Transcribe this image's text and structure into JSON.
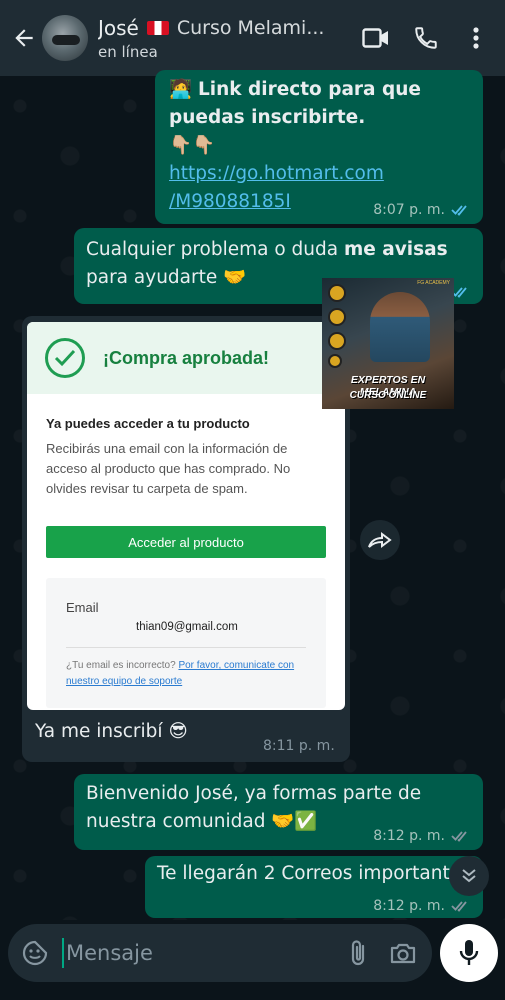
{
  "header": {
    "contact_name": "José",
    "title_extra": "Curso Melami...",
    "status": "en línea",
    "icons": [
      "back-arrow-icon",
      "video-call-icon",
      "phone-icon",
      "more-options-icon"
    ]
  },
  "messages": {
    "m1": {
      "line1": "Link directo para que",
      "line2": "puedas inscribirte.",
      "link_line1": "https://go.hotmart.com",
      "link_line2": "/M98088185I",
      "time": "8:07 p. m."
    },
    "m2": {
      "text_before": "Cualquier problema o duda ",
      "text_bold": "me avisas",
      "line2": "para ayudarte 🤝"
    },
    "m3": {
      "text": "Ya me inscribí 😎",
      "time": "8:11 p. m."
    },
    "m4": {
      "line1": "Bienvenido José, ya formas parte de",
      "line2": "nuestra comunidad 🤝✅",
      "time": "8:12 p. m."
    },
    "m5": {
      "text": "Te llegarán 2 Correos importantes",
      "time": "8:12 p. m."
    }
  },
  "image_card": {
    "title": "¡Compra aprobada!",
    "subtitle": "Ya puedes acceder a tu producto",
    "description": "Recibirás una email con la información de acceso al producto que has comprado. No olvides revisar tu carpeta de spam.",
    "button": "Acceder al producto",
    "email_label": "Email",
    "email_value": "thian09@gmail.com",
    "note_prefix": "¿Tu email es incorrecto? ",
    "note_link": "Por favor, comunicate con nuestro equipo de soporte"
  },
  "promo": {
    "logo": "FG ACADEMY",
    "title": "EXPERTOS EN MELAMINA",
    "subtitle": "CURSO ONLINE"
  },
  "input": {
    "placeholder": "Mensaje"
  },
  "colors": {
    "header_bg": "#1f2c34",
    "chat_bg": "#0b141a",
    "outgoing_bubble": "#005c4b",
    "incoming_bubble": "#1f2c34",
    "link": "#53bdeb",
    "read_ticks": "#53bdeb",
    "approved_green": "#18a24a"
  }
}
